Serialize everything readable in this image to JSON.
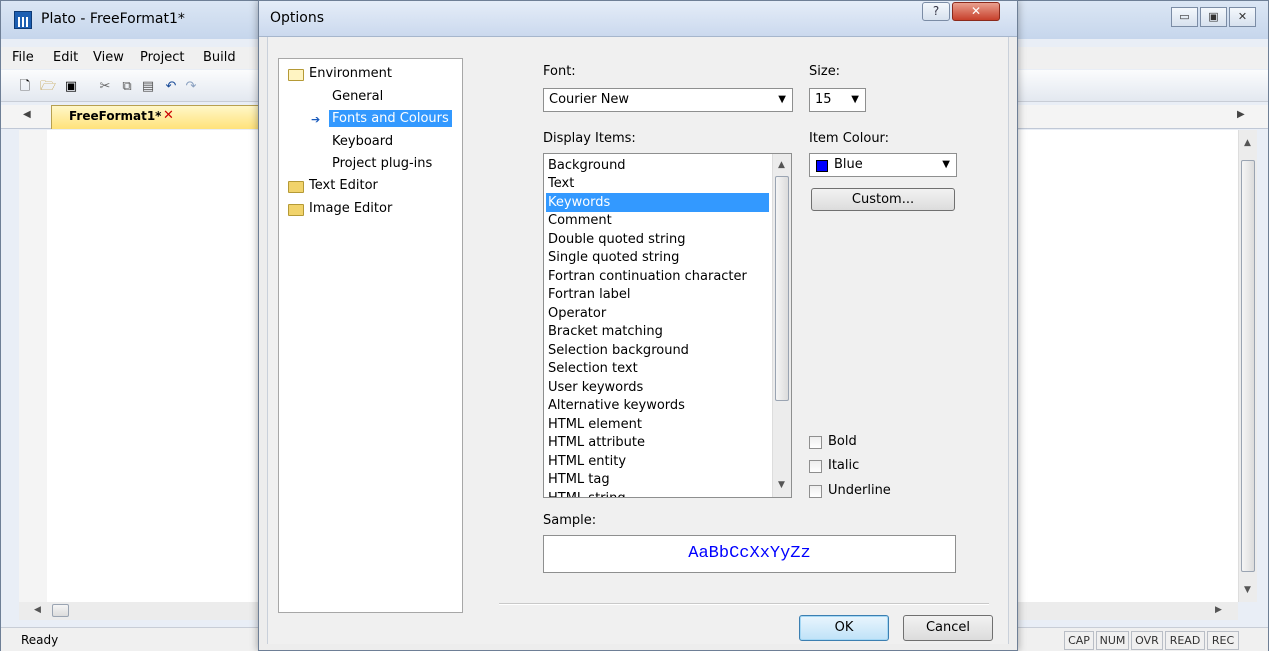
{
  "main_window": {
    "title": "Plato - FreeFormat1*",
    "controls": {
      "minimize": "▭",
      "maximize": "▣",
      "close": "✕"
    }
  },
  "menu": [
    "File",
    "Edit",
    "View",
    "Project",
    "Build"
  ],
  "toolbar_icons": [
    "new-file-icon",
    "open-folder-icon",
    "save-icon",
    "cut-icon",
    "copy-icon",
    "paste-icon",
    "undo-icon",
    "redo-icon"
  ],
  "tabs": {
    "active": "FreeFormat1*",
    "close": "✕"
  },
  "status": {
    "text": "Ready",
    "indicators": [
      "CAP",
      "NUM",
      "OVR",
      "READ",
      "REC"
    ]
  },
  "dialog": {
    "title": "Options",
    "help_button": "?",
    "close_button": "✕",
    "tree": {
      "environment": "Environment",
      "children": [
        "General",
        "Fonts and Colours",
        "Keyboard",
        "Project plug-ins"
      ],
      "selected": "Fonts and Colours",
      "text_editor": "Text Editor",
      "image_editor": "Image Editor"
    },
    "font_label": "Font:",
    "font_value": "Courier New",
    "size_label": "Size:",
    "size_value": "15",
    "display_items_label": "Display Items:",
    "display_items": [
      "Background",
      "Text",
      "Keywords",
      "Comment",
      "Double quoted string",
      "Single quoted string",
      "Fortran continuation character",
      "Fortran label",
      "Operator",
      "Bracket matching",
      "Selection background",
      "Selection text",
      "User keywords",
      "Alternative keywords",
      "HTML element",
      "HTML attribute",
      "HTML entity",
      "HTML tag",
      "HTML string"
    ],
    "selected_item": "Keywords",
    "item_colour_label": "Item Colour:",
    "item_colour_value": "Blue",
    "item_colour_hex": "#0000ff",
    "custom_button": "Custom...",
    "bold_label": "Bold",
    "italic_label": "Italic",
    "underline_label": "Underline",
    "sample_label": "Sample:",
    "sample_text": "AaBbCcXxYyZz",
    "ok_button": "OK",
    "cancel_button": "Cancel"
  }
}
